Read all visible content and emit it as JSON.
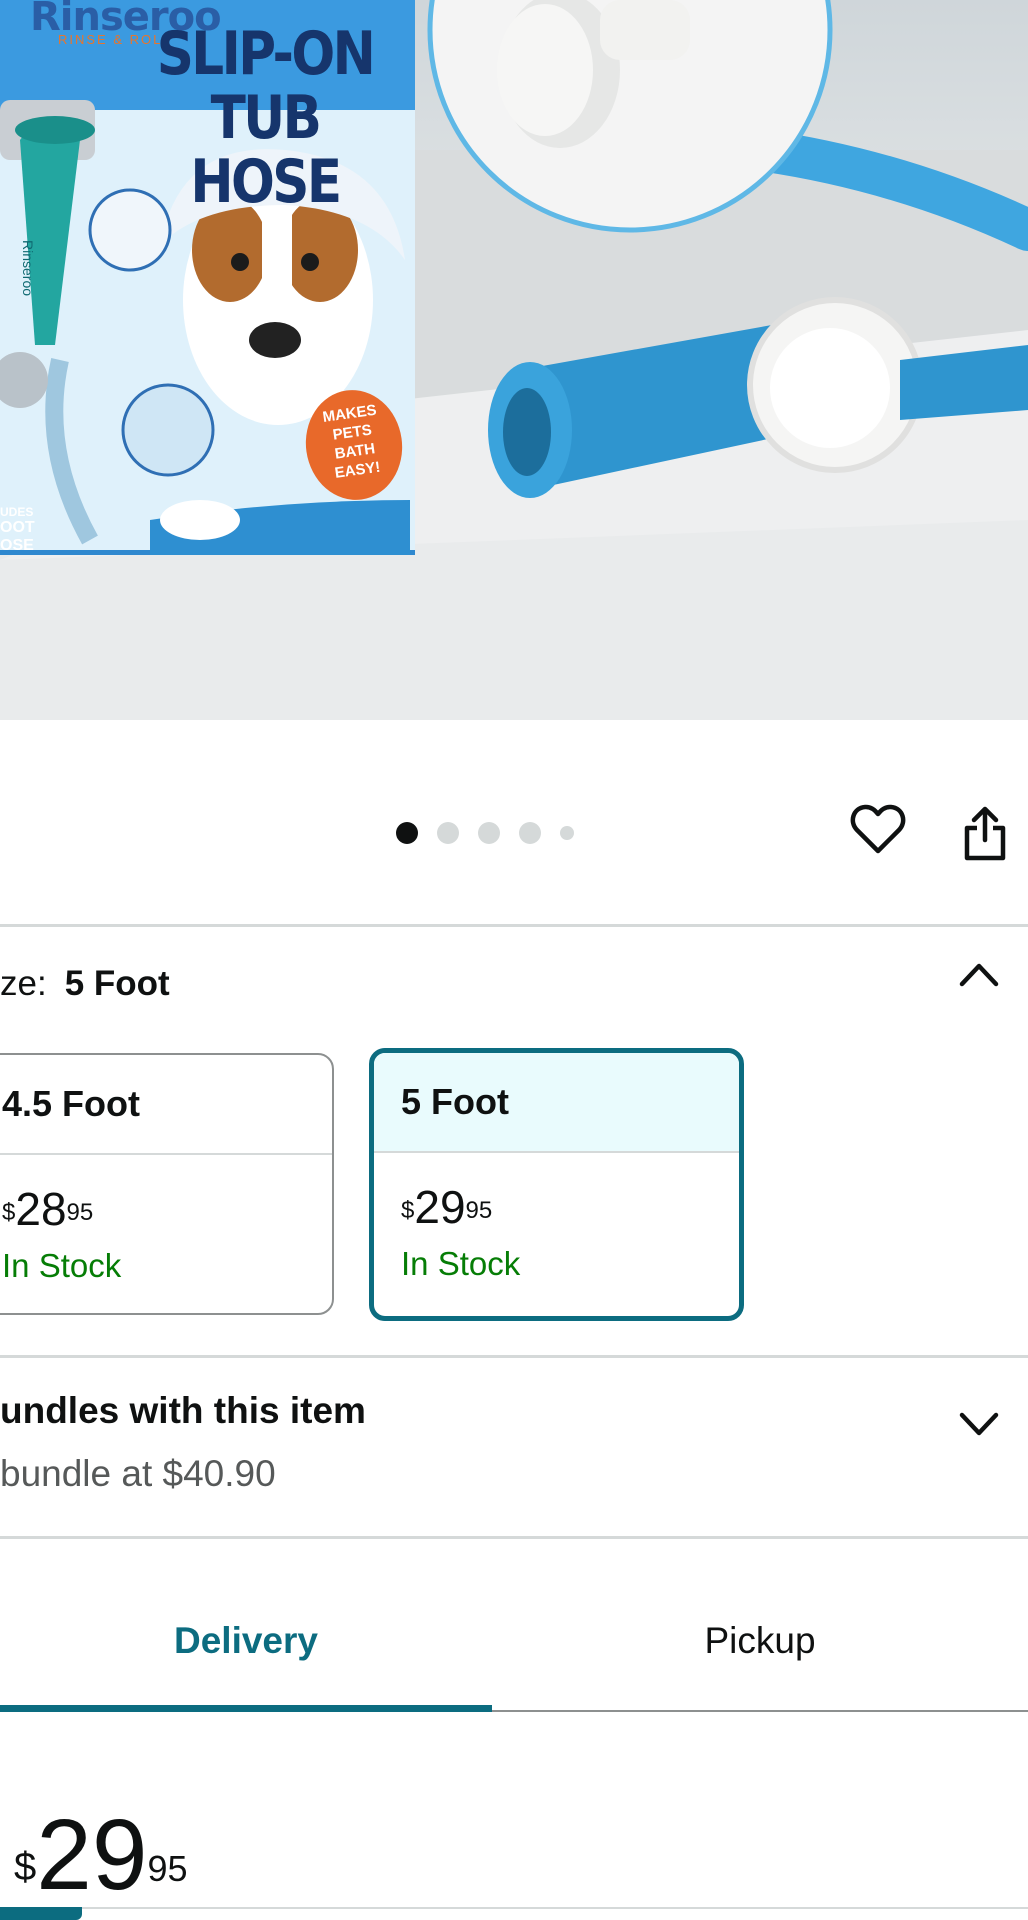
{
  "product_image": {
    "brand": "Rinseroo",
    "brand_tagline": "RINSE & ROLL",
    "box_title_line1": "SLIP-ON",
    "box_title_line2": "TUB HOSE",
    "badge_lines": [
      "MAKES",
      "PETS",
      "BATH",
      "EASY!"
    ],
    "box_edge_lines": [
      "UDES",
      "OOT",
      "OSE"
    ],
    "side_word": "Rinseroo"
  },
  "carousel": {
    "page_count": 5,
    "active_index": 0
  },
  "actions": {
    "wishlist_icon": "heart-outline-icon",
    "share_icon": "share-icon"
  },
  "size": {
    "label_prefix": "ze:",
    "selected_value": "5 Foot",
    "toggle_icon": "chevron-up-icon",
    "options": [
      {
        "name": "4.5 Foot",
        "currency": "$",
        "whole": "28",
        "fraction": "95",
        "availability": "In Stock",
        "selected": false
      },
      {
        "name": "5 Foot",
        "currency": "$",
        "whole": "29",
        "fraction": "95",
        "availability": "In Stock",
        "selected": true
      }
    ]
  },
  "bundles": {
    "title": "undles with this item",
    "subtitle": "bundle at $40.90",
    "toggle_icon": "chevron-down-icon"
  },
  "fulfillment_tabs": [
    {
      "label": "Delivery",
      "active": true
    },
    {
      "label": "Pickup",
      "active": false
    }
  ],
  "price": {
    "currency": "$",
    "whole": "29",
    "fraction": "95"
  },
  "colors": {
    "accent": "#0c6c80",
    "in_stock": "#067d06",
    "selected_card_bg": "#e9fbfd"
  }
}
